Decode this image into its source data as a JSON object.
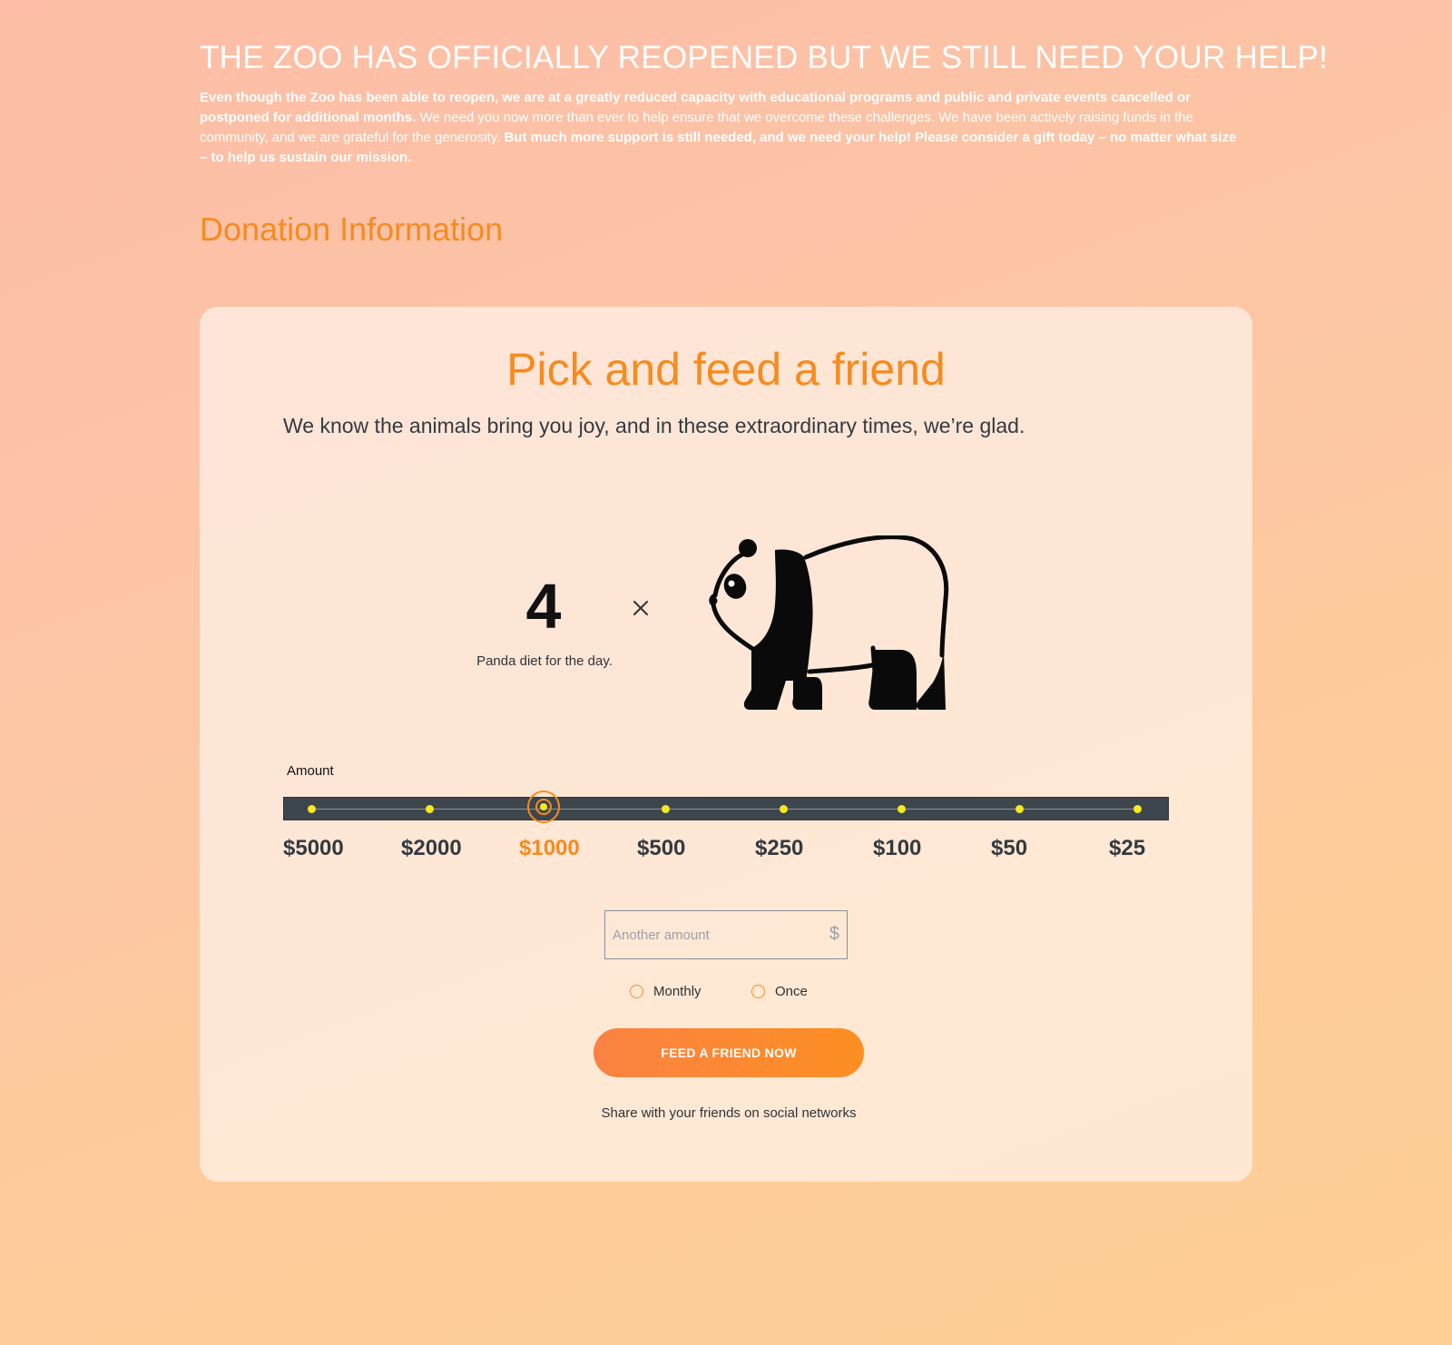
{
  "header": {
    "headline": "THE ZOO HAS OFFICIALLY REOPENED BUT WE STILL NEED YOUR HELP!",
    "intro_bold_1": "Even though the Zoo has been able to reopen, we are at a greatly reduced capacity with educational programs and public and private events cancelled or postponed for additional months.",
    "intro_regular": " We need you now more than ever to help ensure that we overcome these challenges. We have been actively raising funds in the community, and we are grateful for the generosity. ",
    "intro_bold_2": "But much more support is still needed, and we need your help! Please consider a gift today – no matter what size – to help us sustain our mission."
  },
  "section": {
    "title": "Donation Information"
  },
  "card": {
    "title": "Pick and feed a friend",
    "subtitle": "We know the animals bring you joy, and in these extraordinary times, we’re glad.",
    "count": "4",
    "count_label": "Panda diet for the day.",
    "multiply_icon": "times-icon",
    "animal_icon": "panda-icon"
  },
  "slider": {
    "label": "Amount",
    "amounts": [
      "$5000",
      "$2000",
      "$1000",
      "$500",
      "$250",
      "$100",
      "$50",
      "$25"
    ],
    "selected_index": 2
  },
  "custom_amount": {
    "placeholder": "Another amount",
    "value": "",
    "currency_symbol": "$"
  },
  "frequency": {
    "monthly_label": "Monthly",
    "once_label": "Once"
  },
  "cta": {
    "label": "FEED A FRIEND NOW"
  },
  "share": {
    "text": "Share with your friends on social networks"
  },
  "colors": {
    "accent": "#f68b1f",
    "slider_track": "#3e464d",
    "slider_dot": "#f5e91c",
    "text_dark": "#333a40"
  }
}
